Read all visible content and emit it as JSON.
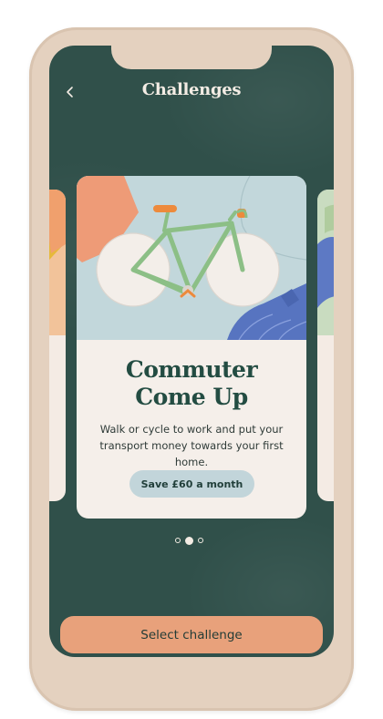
{
  "header": {
    "title": "Challenges",
    "back_icon": "chevron-left-icon"
  },
  "carousel": {
    "active_index": 1,
    "dot_count": 3,
    "card": {
      "title_line1": "Commuter",
      "title_line2": "Come Up",
      "description": "Walk or cycle to work and put your transport money towards your first home.",
      "savings_label": "Save £60 a month",
      "illustration": "bicycle-illustration"
    }
  },
  "footer": {
    "button_label": "Select challenge"
  },
  "colors": {
    "background": "#30504a",
    "frame": "#e4d1bf",
    "card": "#f5efea",
    "title": "#234c42",
    "badge": "#c2d5da",
    "cta": "#e8a17b",
    "illustration_sky": "#c2d7db"
  }
}
